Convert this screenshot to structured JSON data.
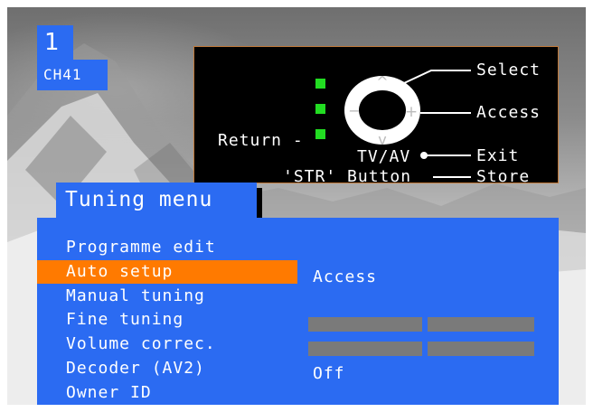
{
  "channel": {
    "number": "1",
    "name": "CH41"
  },
  "help": {
    "select": "Select",
    "access": "Access",
    "return": "Return -",
    "tvav": "TV/AV",
    "exit": "Exit",
    "str": "'STR' Button",
    "store": "Store"
  },
  "menu": {
    "title": "Tuning menu",
    "items": [
      "Programme edit",
      "Auto setup",
      "Manual tuning",
      "Fine tuning",
      "Volume correc.",
      "Decoder (AV2)",
      "Owner ID"
    ],
    "selected_index": 1,
    "auto_setup_value": "Access",
    "decoder_value": "Off"
  },
  "colors": {
    "osd_blue": "#2b6bf2",
    "highlight_orange": "#ff7a00",
    "button_green": "#22dd22",
    "bar_grey": "#7a7a7a"
  }
}
